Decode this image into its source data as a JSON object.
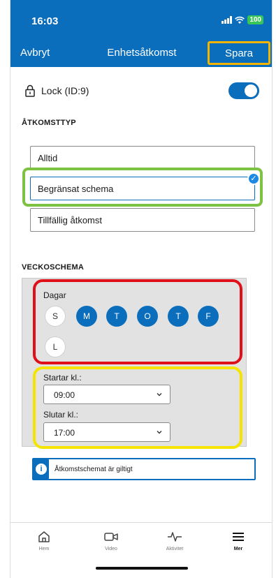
{
  "status": {
    "time": "16:03",
    "battery": "100"
  },
  "nav": {
    "cancel": "Avbryt",
    "title": "Enhetsåtkomst",
    "save": "Spara"
  },
  "lock": {
    "label": "Lock (ID:9)",
    "enabled": true
  },
  "access_type": {
    "title": "ÅTKOMSTTYP",
    "options": [
      "Alltid",
      "Begränsat schema",
      "Tillfällig åtkomst"
    ],
    "selected": "Begränsat schema"
  },
  "weekly": {
    "title": "VECKOSCHEMA",
    "days_label": "Dagar",
    "days": [
      {
        "letter": "S",
        "selected": false
      },
      {
        "letter": "M",
        "selected": true
      },
      {
        "letter": "T",
        "selected": true
      },
      {
        "letter": "O",
        "selected": true
      },
      {
        "letter": "T",
        "selected": true
      },
      {
        "letter": "F",
        "selected": true
      },
      {
        "letter": "L",
        "selected": false
      }
    ],
    "start_label": "Startar kl.:",
    "start_value": "09:00",
    "end_label": "Slutar kl.:",
    "end_value": "17:00"
  },
  "info": {
    "text": "Åtkomstschemat är giltigt"
  },
  "tabs": [
    {
      "label": "Hem",
      "icon": "home-icon"
    },
    {
      "label": "Video",
      "icon": "video-icon"
    },
    {
      "label": "Aktivitet",
      "icon": "activity-icon"
    },
    {
      "label": "Mer",
      "icon": "menu-icon",
      "active": true
    }
  ],
  "colors": {
    "primary": "#0a6ebd",
    "highlight_green": "#7dc242",
    "highlight_red": "#e0101a",
    "highlight_yellow": "#f5e400",
    "highlight_orange": "#f4b400"
  }
}
